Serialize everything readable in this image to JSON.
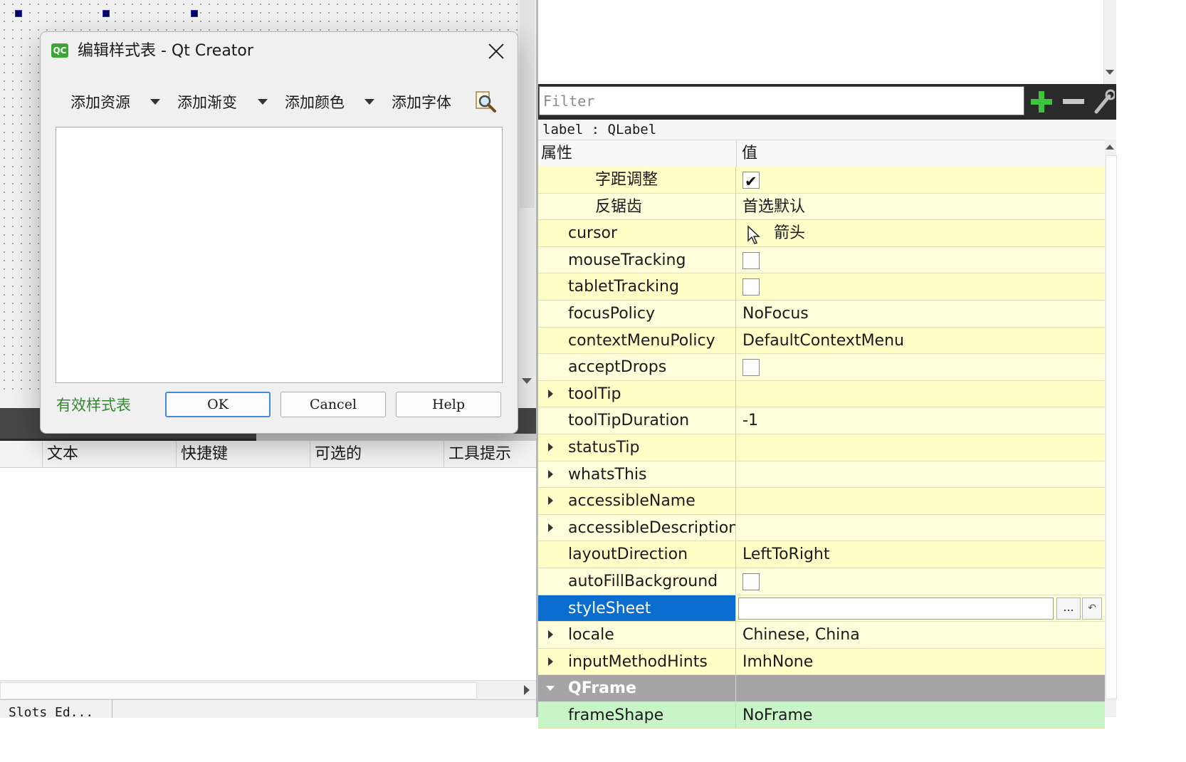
{
  "dialog": {
    "title": "编辑样式表 - Qt Creator",
    "app_icon_text": "QC",
    "toolbar": {
      "add_resource": "添加资源",
      "add_gradient": "添加渐变",
      "add_color": "添加颜色",
      "add_font": "添加字体"
    },
    "editor_text": "",
    "validity_text": "有效样式表",
    "buttons": {
      "ok": "OK",
      "cancel": "Cancel",
      "help": "Help"
    },
    "colors": {
      "validity": "#2e8b2e",
      "ok_border": "#3c8ddb"
    }
  },
  "action_editor": {
    "columns": [
      "文本",
      "快捷键",
      "可选的",
      "工具提示"
    ]
  },
  "bottom_tab": {
    "label": "Slots_Ed..."
  },
  "property_editor": {
    "filter_placeholder": "Filter",
    "object_label": "label : QLabel",
    "header": {
      "property": "属性",
      "value": "值"
    },
    "rows": [
      {
        "name": "字距调整",
        "kind": "checkbox",
        "checked": true,
        "indent": 2
      },
      {
        "name": "反锯齿",
        "value": "首选默认",
        "kind": "text",
        "indent": 2
      },
      {
        "name": "cursor",
        "value": "箭头",
        "kind": "cursor",
        "indent": 1
      },
      {
        "name": "mouseTracking",
        "kind": "checkbox",
        "checked": false,
        "indent": 1
      },
      {
        "name": "tabletTracking",
        "kind": "checkbox",
        "checked": false,
        "indent": 1
      },
      {
        "name": "focusPolicy",
        "value": "NoFocus",
        "kind": "text",
        "indent": 1
      },
      {
        "name": "contextMenuPolicy",
        "value": "DefaultContextMenu",
        "kind": "text",
        "indent": 1
      },
      {
        "name": "acceptDrops",
        "kind": "checkbox",
        "checked": false,
        "indent": 1
      },
      {
        "name": "toolTip",
        "value": "",
        "kind": "text",
        "expandable": true,
        "indent": 1
      },
      {
        "name": "toolTipDuration",
        "value": "-1",
        "kind": "text",
        "indent": 1
      },
      {
        "name": "statusTip",
        "value": "",
        "kind": "text",
        "expandable": true,
        "indent": 1
      },
      {
        "name": "whatsThis",
        "value": "",
        "kind": "text",
        "expandable": true,
        "indent": 1
      },
      {
        "name": "accessibleName",
        "value": "",
        "kind": "text",
        "expandable": true,
        "indent": 1
      },
      {
        "name": "accessibleDescription",
        "value": "",
        "kind": "text",
        "expandable": true,
        "indent": 1
      },
      {
        "name": "layoutDirection",
        "value": "LeftToRight",
        "kind": "text",
        "indent": 1
      },
      {
        "name": "autoFillBackground",
        "kind": "checkbox",
        "checked": false,
        "indent": 1
      },
      {
        "name": "styleSheet",
        "value": "",
        "kind": "stylesheet",
        "selected": true,
        "indent": 1
      },
      {
        "name": "locale",
        "value": "Chinese, China",
        "kind": "text",
        "expandable": true,
        "indent": 1
      },
      {
        "name": "inputMethodHints",
        "value": "ImhNone",
        "kind": "text",
        "expandable": true,
        "indent": 1
      },
      {
        "name": "QFrame",
        "kind": "section",
        "indent": 1
      },
      {
        "name": "frameShape",
        "value": "NoFrame",
        "kind": "text",
        "green": true,
        "indent": 1
      }
    ],
    "stylesheet_more_label": "...",
    "colors": {
      "row_odd": "#ffffc8",
      "row_even": "#ffffdc",
      "selected": "#0b6ccf",
      "section": "#a5a5a5",
      "qframe_row": "#c8f5c8"
    }
  }
}
